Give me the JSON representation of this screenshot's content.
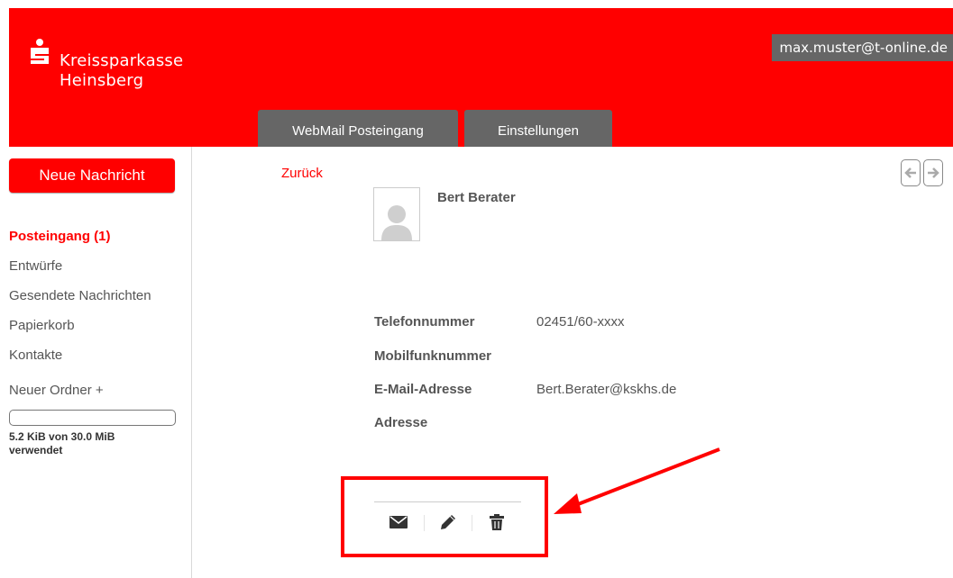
{
  "header": {
    "brand_line1": "Kreissparkasse",
    "brand_line2": "Heinsberg",
    "user_email": "max.muster@t-online.de",
    "tabs": [
      {
        "label": "WebMail Posteingang"
      },
      {
        "label": "Einstellungen"
      }
    ]
  },
  "sidebar": {
    "compose_label": "Neue Nachricht",
    "folders": [
      {
        "label": "Posteingang (1)",
        "active": true
      },
      {
        "label": "Entwürfe"
      },
      {
        "label": "Gesendete Nachrichten"
      },
      {
        "label": "Papierkorb"
      },
      {
        "label": "Kontakte"
      }
    ],
    "new_folder_label": "Neuer Ordner +",
    "quota": {
      "used_fraction": 0.00017,
      "text": "5.2 KiB von 30.0 MiB verwendet"
    }
  },
  "main": {
    "back_label": "Zurück",
    "contact": {
      "name": "Bert Berater",
      "fields": [
        {
          "label": "Telefonnummer",
          "value": "02451/60-xxxx"
        },
        {
          "label": "Mobilfunknummer",
          "value": ""
        },
        {
          "label": "E-Mail-Adresse",
          "value": "Bert.Berater@kskhs.de"
        },
        {
          "label": "Adresse",
          "value": ""
        }
      ]
    },
    "actions": [
      {
        "icon": "envelope-icon"
      },
      {
        "icon": "pencil-icon"
      },
      {
        "icon": "trash-icon"
      }
    ]
  },
  "colors": {
    "brand_red": "#ff0000",
    "tab_gray": "#666666",
    "text_gray": "#555555"
  }
}
